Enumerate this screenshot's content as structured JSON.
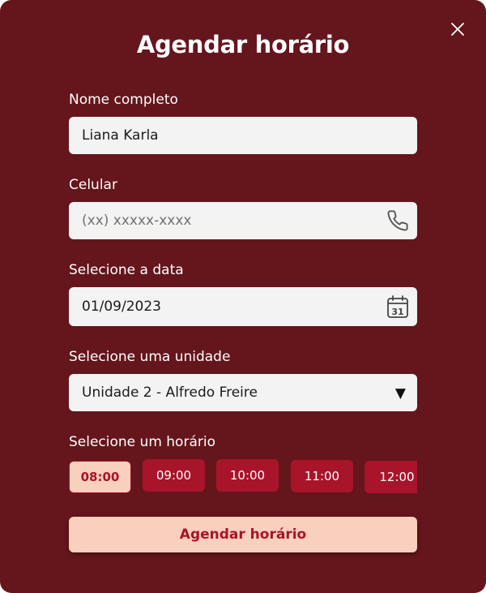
{
  "modal": {
    "title": "Agendar horário",
    "close_icon": "close-icon"
  },
  "form": {
    "name": {
      "label": "Nome completo",
      "value": "Liana Karla"
    },
    "phone": {
      "label": "Celular",
      "value": "",
      "placeholder": "(xx) xxxxx-xxxx",
      "icon": "phone-icon"
    },
    "date": {
      "label": "Selecione a data",
      "value": "01/09/2023",
      "icon": "calendar-icon",
      "icon_text": "31"
    },
    "unit": {
      "label": "Selecione uma unidade",
      "selected": "Unidade 2 - Alfredo Freire",
      "caret": "▼"
    },
    "time": {
      "label": "Selecione um horário",
      "slots": [
        "08:00",
        "09:00",
        "10:00",
        "11:00",
        "12:00"
      ],
      "selected": "08:00"
    },
    "submit_label": "Agendar horário"
  },
  "colors": {
    "background": "#64161c",
    "accent": "#a8142a",
    "accent_light": "#f9cfbd",
    "field": "#f3f3f3"
  }
}
